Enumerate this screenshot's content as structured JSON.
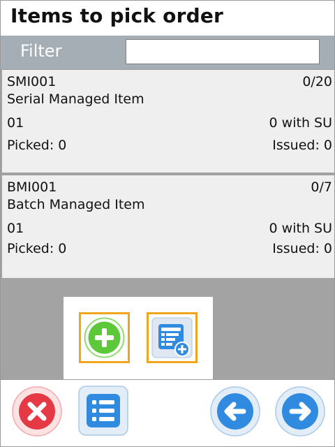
{
  "header": {
    "title": "Items to pick order"
  },
  "filter": {
    "label": "Filter",
    "value": "",
    "placeholder": ""
  },
  "items": [
    {
      "code": "SMI001",
      "qty": "0/20",
      "name": "Serial Managed Item",
      "warehouse": "01",
      "su": "0 with SU",
      "picked": "Picked: 0",
      "issued": "Issued: 0"
    },
    {
      "code": "BMI001",
      "qty": "0/7",
      "name": "Batch Managed Item",
      "warehouse": "01",
      "su": "0 with SU",
      "picked": "Picked: 0",
      "issued": "Issued: 0"
    }
  ],
  "popup": {
    "icons": [
      "plus-circle-icon",
      "list-add-icon"
    ]
  },
  "toolbar": {
    "icons": [
      "close-icon",
      "list-icon",
      "arrow-left-icon",
      "arrow-right-icon"
    ]
  },
  "colors": {
    "filter_bar": "#a5adb5",
    "highlight": "#f0a61c",
    "red": "#e53945",
    "blue": "#2f8ae0",
    "green": "#5cc83a"
  }
}
